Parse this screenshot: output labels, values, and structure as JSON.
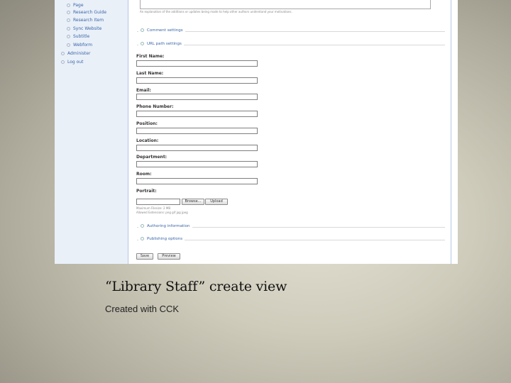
{
  "sidebar": {
    "items": [
      {
        "label": "Page"
      },
      {
        "label": "Research Guide"
      },
      {
        "label": "Research Item"
      },
      {
        "label": "Sync Website"
      },
      {
        "label": "Subtitle"
      },
      {
        "label": "Webform"
      }
    ],
    "admin": "Administer",
    "logout": "Log out"
  },
  "form": {
    "log_help": "An explanation of the additions or updates being made to help other authors understand your motivations.",
    "sections": {
      "comment_settings": "Comment settings",
      "url_path_settings": "URL path settings",
      "authoring_information": "Authoring information",
      "publishing_options": "Publishing options"
    },
    "fields": [
      {
        "label": "First Name:",
        "value": ""
      },
      {
        "label": "Last Name:",
        "value": ""
      },
      {
        "label": "Email:",
        "value": ""
      },
      {
        "label": "Phone Number:",
        "value": ""
      },
      {
        "label": "Position:",
        "value": ""
      },
      {
        "label": "Location:",
        "value": ""
      },
      {
        "label": "Department:",
        "value": ""
      },
      {
        "label": "Room:",
        "value": ""
      }
    ],
    "portrait": {
      "label": "Portrait:",
      "browse_label": "Browse...",
      "upload_label": "Upload",
      "help_line1": "Maximum Filesize: 2 MB",
      "help_line2": "Allowed Extensions: png gif jpg jpeg"
    },
    "buttons": {
      "save": "Save",
      "preview": "Preview"
    }
  },
  "caption": {
    "title": "“Library Staff” create view",
    "subtitle": "Created with CCK"
  }
}
